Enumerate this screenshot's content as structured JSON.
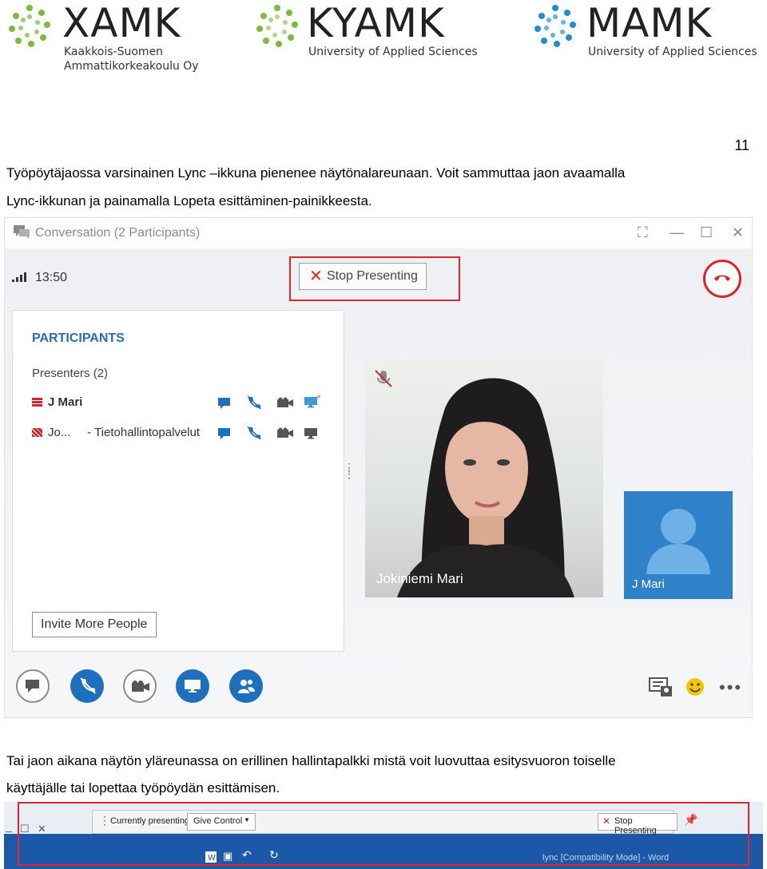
{
  "logos": [
    {
      "name": "XAMK",
      "subtitle_line1": "Kaakkois-Suomen",
      "subtitle_line2": "Ammattikorkeakoulu Oy"
    },
    {
      "name": "KYAMK",
      "subtitle_line1": "University of Applied Sciences"
    },
    {
      "name": "MAMK",
      "subtitle_line1": "University of Applied Sciences"
    }
  ],
  "page_number": "11",
  "paragraph1": {
    "line1": "Työpöytäjaossa varsinainen Lync –ikkuna pienenee näytönalareunaan. Voit sammuttaa jaon avaamalla",
    "line2": "Lync-ikkunan ja painamalla Lopeta esittäminen-painikkeesta."
  },
  "lync": {
    "title": "Conversation (2 Participants)",
    "time": "13:50",
    "stop_presenting": "Stop Presenting",
    "participants_heading": "PARTICIPANTS",
    "presenters_label": "Presenters (2)",
    "participants": [
      {
        "name": "J Mari"
      },
      {
        "name": "Jo...     - Tietohallintopalvelut"
      }
    ],
    "invite_button": "Invite More People",
    "video_name": "Jokiniemi Mari",
    "self_name": "J Mari",
    "colors": {
      "accent_blue": "#1f6fbf",
      "hangup_red": "#d9262b",
      "header_blue": "#2a6db0"
    }
  },
  "paragraph2": {
    "line1": "Tai jaon aikana näytön yläreunassa on erillinen hallintapalkki mistä voit luovuttaa esitysvuoron toiselle",
    "line2": "käyttäjälle tai lopettaa työpöydän esittämisen."
  },
  "sharing_bar": {
    "currently_presenting": "Currently presenting",
    "give_control": "Give Control",
    "stop_presenting": "Stop Presenting",
    "word_title": "lync [Compatibility Mode] - Word"
  }
}
